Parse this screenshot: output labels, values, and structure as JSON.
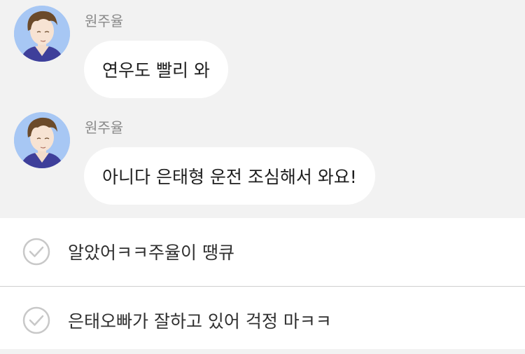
{
  "messages": [
    {
      "sender": "원주율",
      "text": "연우도 빨리 와"
    },
    {
      "sender": "원주율",
      "text": "아니다 은태형 운전 조심해서 와요!"
    }
  ],
  "choices": [
    {
      "label": "알았어ㅋㅋ주율이 땡큐",
      "icon": "check-circle-icon"
    },
    {
      "label": "은태오빠가 잘하고 있어 걱정 마ㅋㅋ",
      "icon": "check-circle-icon"
    }
  ],
  "colors": {
    "chat_background": "#f2f2f2",
    "bubble": "#ffffff",
    "avatar_background": "#a7c7f4",
    "choice_icon": "#c8c8c8"
  }
}
